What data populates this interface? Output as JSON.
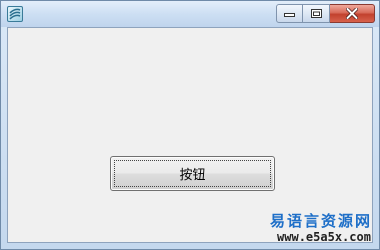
{
  "window": {
    "icon": "app-icon",
    "controls": {
      "minimize_icon": "minimize-icon",
      "maximize_icon": "maximize-icon",
      "close_icon": "close-icon"
    },
    "close_color": "#c2412e"
  },
  "client": {
    "button_label": "按钮"
  },
  "watermark": {
    "title": "易语言资源网",
    "url": "www.e5a5x.com",
    "title_color": "#1e6fc8"
  }
}
